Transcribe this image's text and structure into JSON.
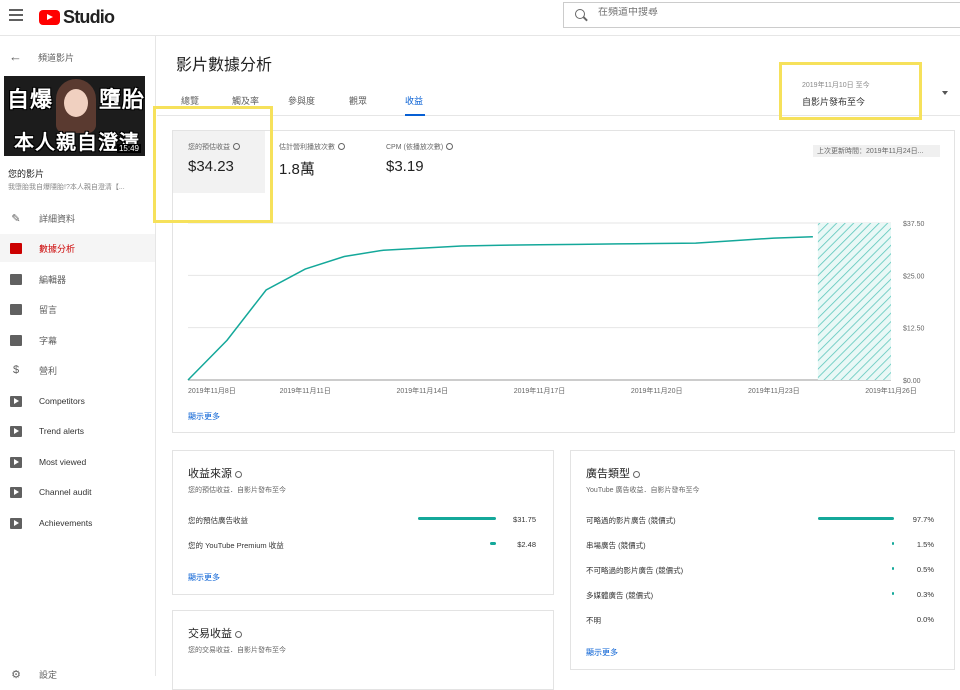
{
  "header": {
    "brand": "Studio",
    "search_placeholder": "在頻道中搜尋"
  },
  "sidebar": {
    "back_label": "頻道影片",
    "thumbnail": {
      "text_left": "自爆",
      "text_right": "墮胎",
      "text_bottom": "本人親自澄清",
      "duration": "15:49"
    },
    "your_video": "您的影片",
    "video_title": "我墮胎我自爆隱胎!?本人親自澄清【...",
    "items": [
      {
        "label": "詳細資料",
        "icon": "pencil-icon"
      },
      {
        "label": "數據分析",
        "icon": "analytics-icon",
        "active": true
      },
      {
        "label": "編輯器",
        "icon": "clapperboard-icon"
      },
      {
        "label": "留言",
        "icon": "comment-icon"
      },
      {
        "label": "字幕",
        "icon": "subtitles-icon"
      },
      {
        "label": "營利",
        "icon": "dollar-icon"
      },
      {
        "label": "Competitors",
        "icon": "play-icon"
      },
      {
        "label": "Trend alerts",
        "icon": "play-icon"
      },
      {
        "label": "Most viewed",
        "icon": "play-icon"
      },
      {
        "label": "Channel audit",
        "icon": "play-icon"
      },
      {
        "label": "Achievements",
        "icon": "play-icon"
      },
      {
        "label": "設定",
        "icon": "gear-icon"
      }
    ]
  },
  "main": {
    "title": "影片數據分析",
    "tabs": [
      "總覽",
      "觸及率",
      "參與度",
      "觀眾",
      "收益"
    ],
    "active_tab": "收益",
    "date_range": {
      "line1": "2019年11月10日 至今",
      "line2": "自影片發布至今"
    },
    "metrics": [
      {
        "label": "您的預估收益",
        "value": "$34.23"
      },
      {
        "label": "估計營利播放次數",
        "value": "1.8萬"
      },
      {
        "label": "CPM (依播放次數)",
        "value": "$3.19"
      }
    ],
    "last_updated": "上次更新時間：2019年11月24日...",
    "show_more": "顯示更多"
  },
  "chart_data": {
    "type": "line",
    "x": [
      "2019年11月8日",
      "2019年11月9日",
      "2019年11月10日",
      "2019年11月11日",
      "2019年11月12日",
      "2019年11月13日",
      "2019年11月14日",
      "2019年11月15日",
      "2019年11月16日",
      "2019年11月17日",
      "2019年11月18日",
      "2019年11月19日",
      "2019年11月20日",
      "2019年11月21日",
      "2019年11月22日",
      "2019年11月23日",
      "2019年11月24日"
    ],
    "x_tick_labels": [
      "2019年11月8日",
      "2019年11月11日",
      "2019年11月14日",
      "2019年11月17日",
      "2019年11月20日",
      "2019年11月23日",
      "2019年11月26日"
    ],
    "series": [
      {
        "values": [
          0,
          9.5,
          21.5,
          26.5,
          29.5,
          31.0,
          31.5,
          32.0,
          32.2,
          32.3,
          32.4,
          32.5,
          32.6,
          32.7,
          33.3,
          33.9,
          34.23
        ]
      }
    ],
    "yticks": [
      "$37.50",
      "$25.00",
      "$12.50",
      "$0.00"
    ],
    "ylim": [
      0,
      37.5
    ],
    "projected_region": [
      "2019年11月24日",
      "2019年11月26日"
    ],
    "grid": true,
    "color": "#14a89a"
  },
  "revenue_sources": {
    "title": "收益來源",
    "subtitle": "您的預估收益．自影片發布至今",
    "rows": [
      {
        "label": "您的預估廣告收益",
        "value": "$31.75",
        "amount": 31.75
      },
      {
        "label": "您的 YouTube Premium 收益",
        "value": "$2.48",
        "amount": 2.48
      }
    ],
    "show_more": "顯示更多"
  },
  "ad_types": {
    "title": "廣告類型",
    "subtitle": "YouTube 廣告收益．自影片發布至今",
    "rows": [
      {
        "label": "可略過的影片廣告 (競價式)",
        "value": "97.7%",
        "pct": 97.7
      },
      {
        "label": "串場廣告 (競價式)",
        "value": "1.5%",
        "pct": 1.5
      },
      {
        "label": "不可略過的影片廣告 (競價式)",
        "value": "0.5%",
        "pct": 0.5
      },
      {
        "label": "多媒體廣告 (競價式)",
        "value": "0.3%",
        "pct": 0.3
      },
      {
        "label": "不明",
        "value": "0.0%",
        "pct": 0
      }
    ],
    "show_more": "顯示更多"
  },
  "transactions": {
    "title": "交易收益",
    "subtitle": "您的交易收益．自影片發布至今"
  },
  "colors": {
    "accent": "#14a89a",
    "highlight": "#f6e15b",
    "link": "#065fd4",
    "active_nav": "#cc0000"
  }
}
